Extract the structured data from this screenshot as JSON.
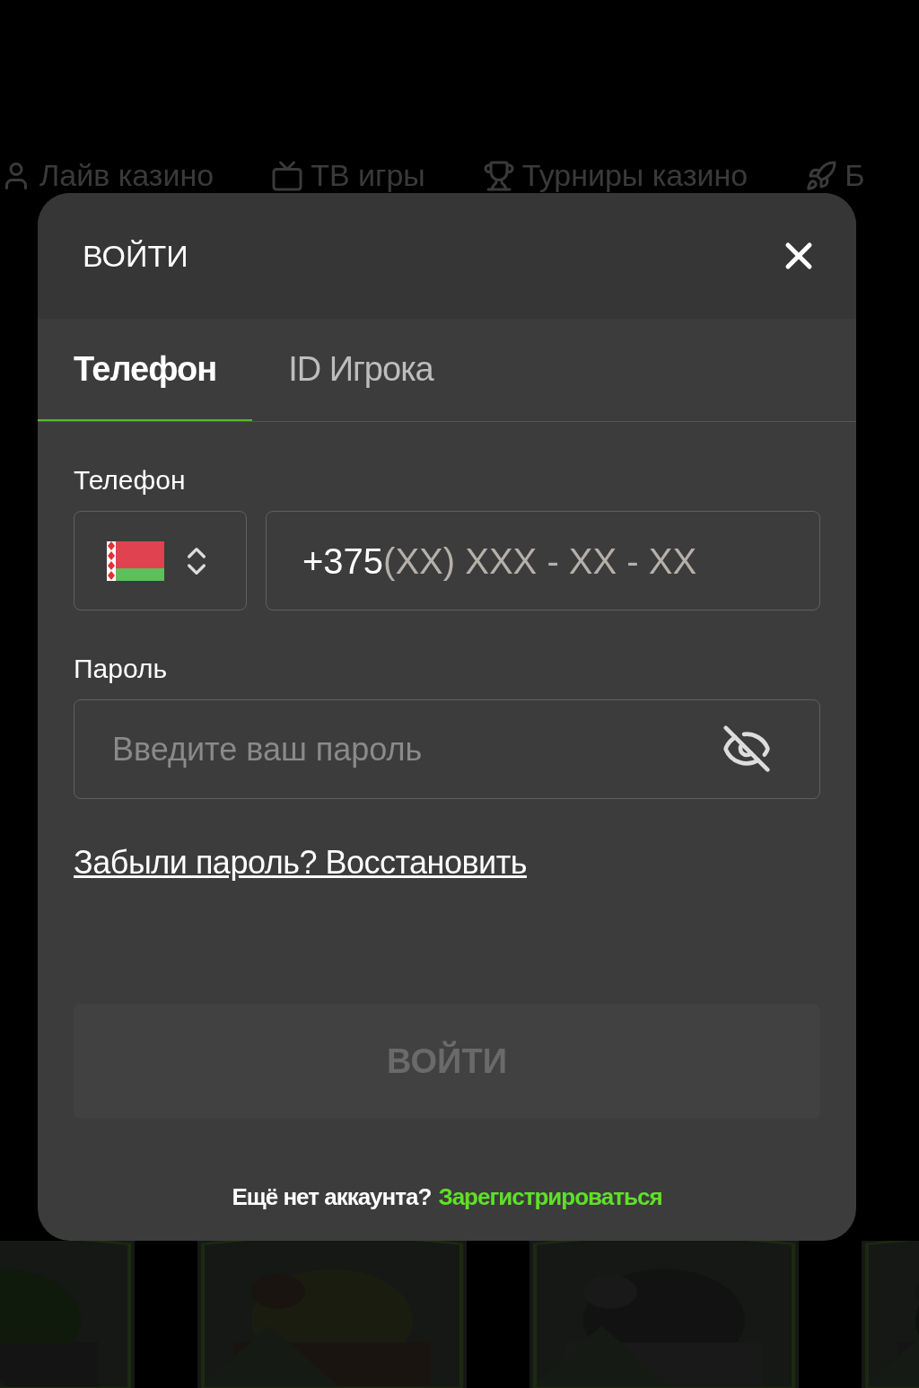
{
  "nav": [
    {
      "label": "Лайв казино",
      "kind": "dealer"
    },
    {
      "label": "ТВ игры",
      "kind": "tv"
    },
    {
      "label": "Турниры казино",
      "kind": "trophy"
    },
    {
      "label": "Б",
      "kind": "rocket"
    }
  ],
  "modal": {
    "title": "ВОЙТИ",
    "tabs": [
      {
        "label": "Телефон",
        "selected": true
      },
      {
        "label": "ID Игрока",
        "selected": false
      }
    ],
    "phone": {
      "label": "Телефон",
      "value": "+375",
      "mask": "(XX) XXX - XX - XX"
    },
    "password": {
      "label": "Пароль",
      "placeholder": "Введите ваш пароль"
    },
    "forgot_link": "Забыли пароль? Восстановить",
    "submit": {
      "label": "ВОЙТИ",
      "disabled": true
    },
    "footer": {
      "text": "Ещё нет аккаунта?",
      "link": "Зарегистрироваться"
    }
  }
}
